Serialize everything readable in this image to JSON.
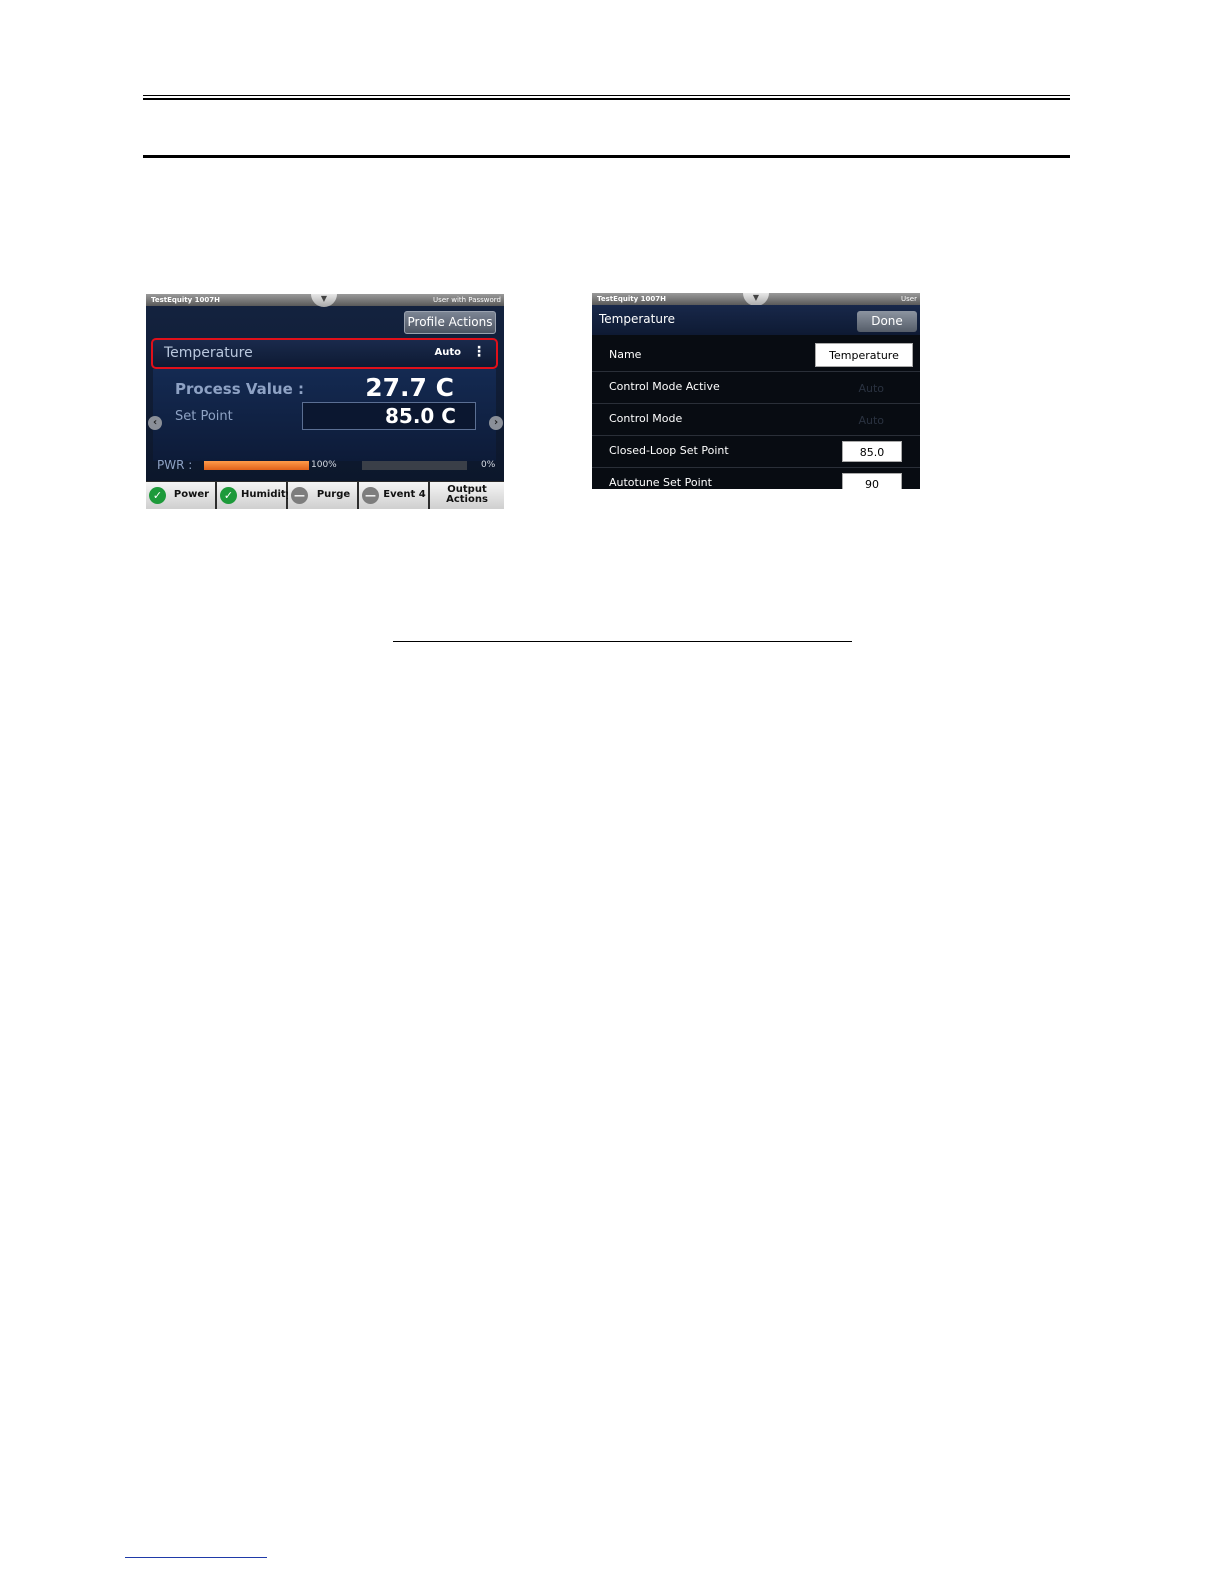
{
  "screen1": {
    "topbar": {
      "device": "TestEquity 1007H",
      "user": "User with Password",
      "tab_glyph": "▼"
    },
    "profile_actions": "Profile Actions",
    "loop": {
      "name": "Temperature",
      "mode": "Auto",
      "more_glyph": "⋮"
    },
    "process_value_label": "Process Value :",
    "process_value": "27.7 C",
    "set_point_label": "Set Point",
    "set_point": "85.0 C",
    "prev_glyph": "‹",
    "next_glyph": "›",
    "pwr_label": "PWR :",
    "heat_pct_label": "100%",
    "heat_level": 1.0,
    "cool_pct_label": "0%",
    "cool_level": 0.0,
    "outputs": [
      {
        "label": "Power",
        "state": "on",
        "glyph": "✓"
      },
      {
        "label": "Humidity",
        "state": "on",
        "glyph": "✓"
      },
      {
        "label": "Purge",
        "state": "off",
        "glyph": "—"
      },
      {
        "label": "Event 4",
        "state": "off",
        "glyph": "—"
      }
    ],
    "output_actions_line1": "Output",
    "output_actions_line2": "Actions"
  },
  "screen2": {
    "topbar": {
      "device": "TestEquity 1007H",
      "user": "User",
      "tab_glyph": "▼"
    },
    "title": "Temperature",
    "done": "Done",
    "rows": [
      {
        "label": "Name",
        "value": "Temperature"
      },
      {
        "label": "Control Mode Active",
        "value": "Auto"
      },
      {
        "label": "Control Mode",
        "value": "Auto"
      },
      {
        "label": "Closed-Loop Set Point",
        "value": "85.0"
      },
      {
        "label": "Autotune Set Point",
        "value": "90"
      }
    ]
  },
  "colors": {
    "highlight_border": "#e0101a",
    "heat_bar": "#e0611a",
    "output_on": "#1d9a3a",
    "output_off": "#7d7d7d"
  }
}
